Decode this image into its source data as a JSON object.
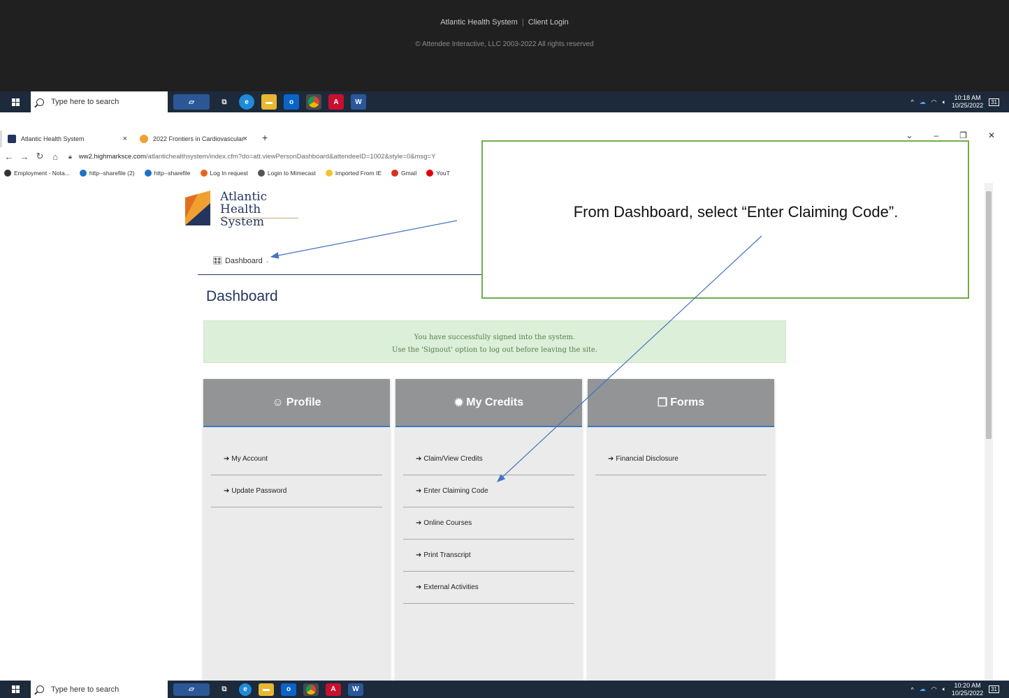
{
  "top_footer": {
    "brand": "Atlantic Health System",
    "login": "Client Login",
    "copyright": "© Attendee Interactive, LLC 2003-2022 All rights reserved"
  },
  "taskbar_top": {
    "search_placeholder": "Type here to search",
    "time": "10:18 AM",
    "date": "10/25/2022",
    "notif": "31"
  },
  "taskbar_bottom": {
    "search_placeholder": "Type here to search",
    "time": "10:20 AM",
    "date": "10/25/2022",
    "notif": "31"
  },
  "browser": {
    "tabs": [
      {
        "label": "Atlantic Health System"
      },
      {
        "label": "2022 Frontiers in Cardiovascular"
      }
    ],
    "new_tab": "+",
    "url_host": "ww2.highmarksce.com",
    "url_path": "/atlantichealthsystem/index.cfm?do=att.viewPersonDashboard&attendeeID=1002&style=0&msg=Y",
    "bookmarks": [
      {
        "label": "Employment - Nota...",
        "color": "#333333"
      },
      {
        "label": "http--sharefile (2)",
        "color": "#1a73c8"
      },
      {
        "label": "http--sharefile",
        "color": "#1a73c8"
      },
      {
        "label": "Log In request",
        "color": "#e8641e"
      },
      {
        "label": "Login to Mimecast",
        "color": "#555555"
      },
      {
        "label": "Imported From IE",
        "color": "#f4c430"
      },
      {
        "label": "Gmail",
        "color": "#d93025"
      },
      {
        "label": "YouT",
        "color": "#e00000"
      }
    ]
  },
  "page": {
    "logo_line1": "Atlantic",
    "logo_line2": "Health System",
    "nav_dashboard": "Dashboard",
    "title": "Dashboard",
    "alert_line1": "You have successfully signed into the system.",
    "alert_line2": "Use the 'Signout' option to log out before leaving the site.",
    "panels": {
      "profile": {
        "title": "Profile",
        "items": [
          "My Account",
          "Update Password"
        ]
      },
      "credits": {
        "title": "My Credits",
        "items": [
          "Claim/View Credits",
          "Enter Claiming Code",
          "Online Courses",
          "Print Transcript",
          "External Activities"
        ]
      },
      "forms": {
        "title": "Forms",
        "items": [
          "Financial Disclosure"
        ]
      }
    }
  },
  "callout": {
    "text": "From Dashboard, select “Enter Claiming Code”."
  },
  "colors": {
    "accent": "#23345e",
    "panel_head": "#939496",
    "callout_border": "#70ad47",
    "alert_bg": "#dcefd8"
  }
}
